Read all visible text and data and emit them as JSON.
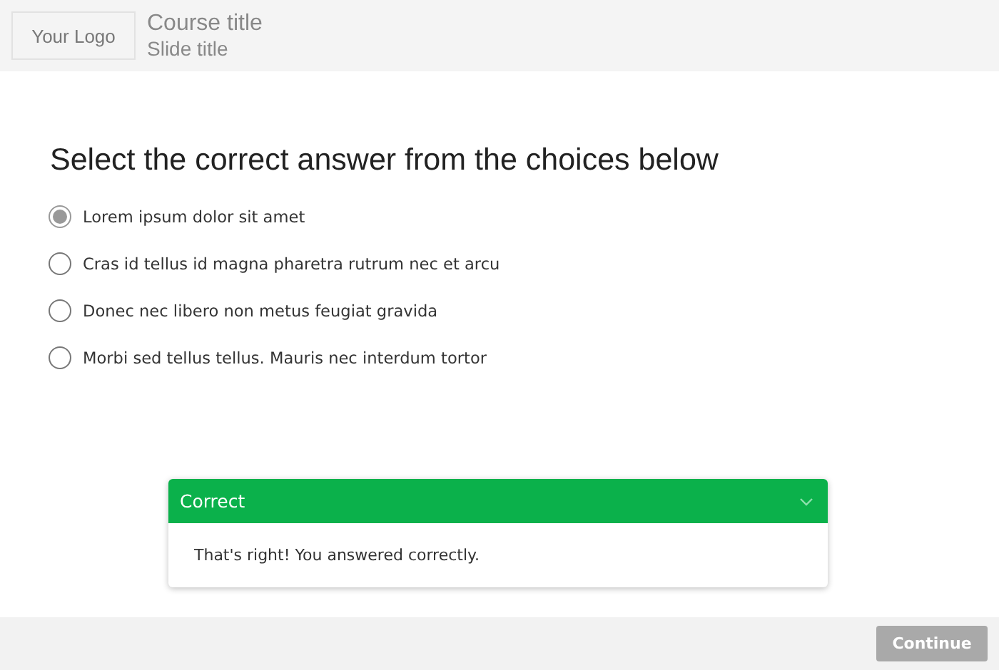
{
  "header": {
    "logo": "Your Logo",
    "course_title": "Course title",
    "slide_title": "Slide title"
  },
  "question": "Select the correct answer from the choices below",
  "choices": [
    {
      "label": "Lorem ipsum dolor sit amet",
      "selected": true
    },
    {
      "label": "Cras id tellus id magna pharetra rutrum nec et arcu",
      "selected": false
    },
    {
      "label": "Donec nec libero non metus feugiat gravida",
      "selected": false
    },
    {
      "label": "Morbi sed tellus tellus. Mauris nec interdum tortor",
      "selected": false
    }
  ],
  "feedback": {
    "title": "Correct",
    "message": "That's right! You answered correctly.",
    "expanded": true
  },
  "footer": {
    "continue_button": {
      "label": "Continue",
      "disabled": true
    }
  }
}
